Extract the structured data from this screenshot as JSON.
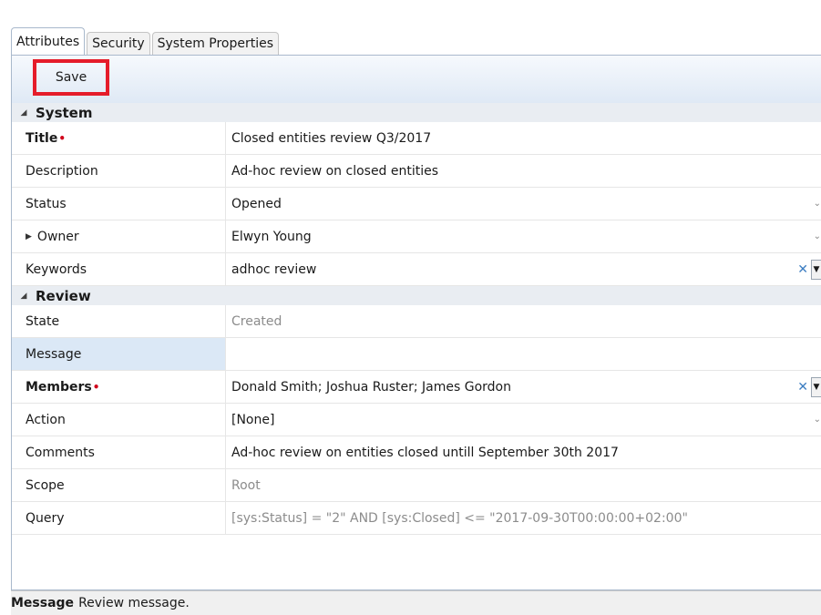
{
  "tabs": [
    "Attributes",
    "Security",
    "System Properties"
  ],
  "toolbar": {
    "save_label": "Save"
  },
  "sections": {
    "system": "System",
    "review": "Review"
  },
  "rows": {
    "title": {
      "label": "Title",
      "value": "Closed entities review Q3/2017"
    },
    "description": {
      "label": "Description",
      "value": "Ad-hoc review on closed entities"
    },
    "status": {
      "label": "Status",
      "value": "Opened"
    },
    "owner": {
      "label": "Owner",
      "value": "Elwyn Young"
    },
    "keywords": {
      "label": "Keywords",
      "value": "adhoc review"
    },
    "state": {
      "label": "State",
      "value": "Created"
    },
    "message": {
      "label": "Message",
      "value": ""
    },
    "members": {
      "label": "Members",
      "value": "Donald Smith; Joshua Ruster; James Gordon"
    },
    "action": {
      "label": "Action",
      "value": "[None]"
    },
    "comments": {
      "label": "Comments",
      "value": "Ad-hoc review on entities closed untill September 30th 2017"
    },
    "scope": {
      "label": "Scope",
      "value": "Root"
    },
    "query": {
      "label": "Query",
      "value": "[sys:Status] = \"2\" AND [sys:Closed] <= \"2017-09-30T00:00:00+02:00\""
    }
  },
  "required_mark": "•",
  "status_bar": {
    "field": "Message",
    "text": "Review message."
  },
  "colors": {
    "highlight_border": "#e51c2a",
    "selected_row": "#dbe8f6",
    "required": "#d0021b"
  }
}
